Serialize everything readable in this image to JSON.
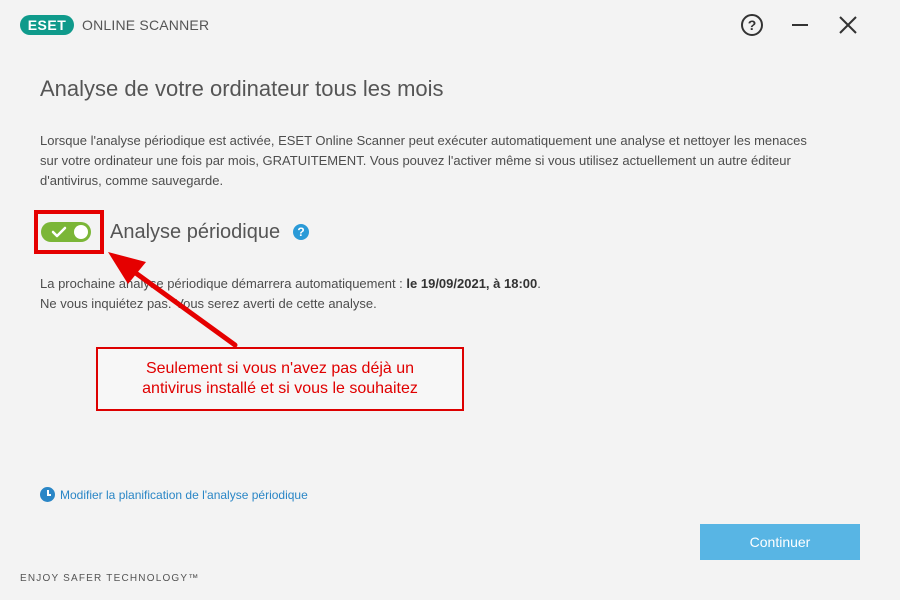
{
  "titlebar": {
    "logo": "ESET",
    "app_name": "ONLINE SCANNER",
    "help_icon": "question-circle-icon",
    "minimize_icon": "minimize-icon",
    "close_icon": "close-icon"
  },
  "main": {
    "title": "Analyse de votre ordinateur tous les mois",
    "description_lines": [
      "Lorsque l'analyse périodique est activée, ESET Online Scanner peut exécuter automatiquement une analyse et nettoyer les menaces",
      "sur votre ordinateur une fois par mois, GRATUITEMENT. Vous pouvez l'activer même si vous utilisez actuellement un autre éditeur",
      "d'antivirus, comme sauvegarde."
    ],
    "toggle": {
      "label": "Analyse périodique",
      "state": "on",
      "help": "?"
    },
    "info_line1_prefix": "La prochaine analyse périodique démarrera automatiquement : ",
    "info_line1_bold": "le 19/09/2021, à 18:00",
    "info_line1_suffix": ".",
    "info_line2": "Ne vous inquiétez pas. Vous serez averti de cette analyse.",
    "schedule_link": "Modifier la planification de l'analyse périodique",
    "continue_button": "Continuer"
  },
  "footer": {
    "tagline": "ENJOY SAFER TECHNOLOGY™"
  },
  "annotation": {
    "callout_line1": "Seulement si vous n'avez pas déjà un",
    "callout_line2": "antivirus installé et si vous le souhaitez"
  },
  "colors": {
    "accent_green": "#7bb637",
    "accent_blue": "#58b5e4",
    "link_blue": "#2a86c6",
    "annotation_red": "#e50000",
    "brand_teal": "#0f9a8b"
  }
}
